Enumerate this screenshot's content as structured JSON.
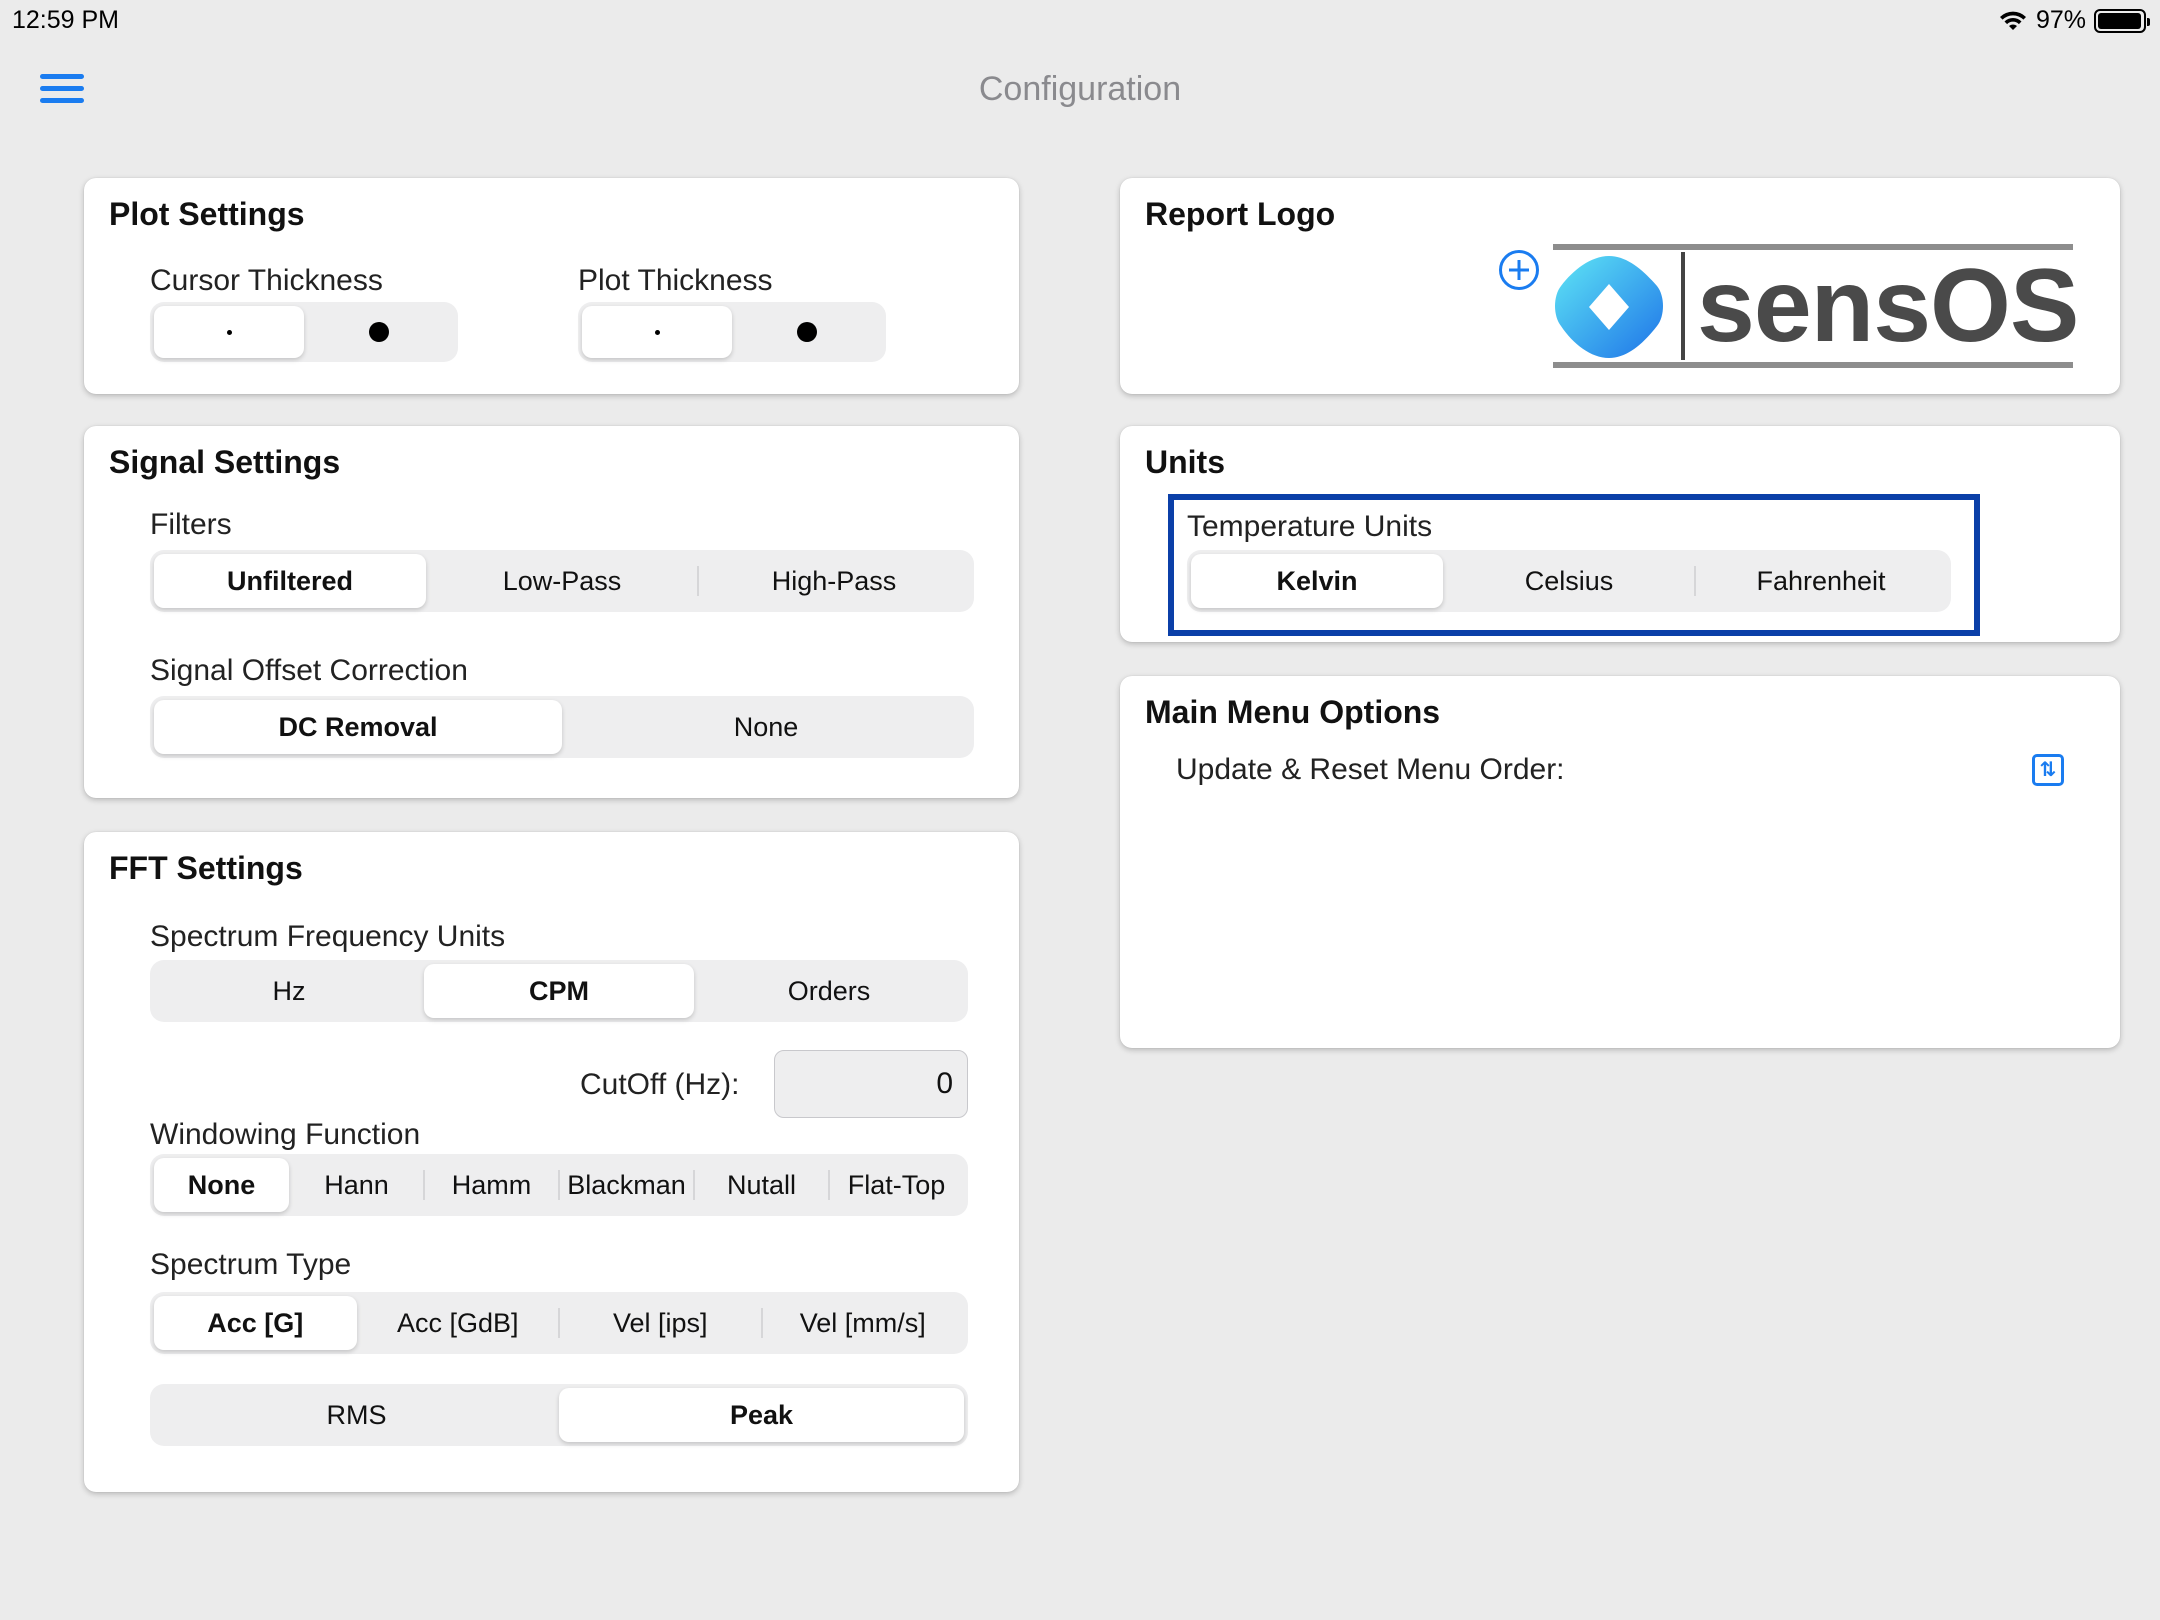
{
  "status_bar": {
    "time": "12:59 PM",
    "battery": "97%",
    "battery_level": 0.97
  },
  "nav": {
    "title": "Configuration"
  },
  "plot_settings": {
    "title": "Plot Settings",
    "cursor_thickness_label": "Cursor Thickness",
    "plot_thickness_label": "Plot Thickness",
    "cursor_selected": "thin",
    "plot_selected": "thin"
  },
  "signal_settings": {
    "title": "Signal Settings",
    "filters_label": "Filters",
    "filters": [
      "Unfiltered",
      "Low-Pass",
      "High-Pass"
    ],
    "filters_selected": "Unfiltered",
    "offset_label": "Signal Offset Correction",
    "offset_options": [
      "DC Removal",
      "None"
    ],
    "offset_selected": "DC Removal"
  },
  "fft_settings": {
    "title": "FFT Settings",
    "freq_units_label": "Spectrum Frequency Units",
    "freq_units": [
      "Hz",
      "CPM",
      "Orders"
    ],
    "freq_units_selected": "CPM",
    "cutoff_label": "CutOff (Hz):",
    "cutoff_value": "0",
    "windowing_label": "Windowing Function",
    "windowing": [
      "None",
      "Hann",
      "Hamm",
      "Blackman",
      "Nutall",
      "Flat-Top"
    ],
    "windowing_selected": "None",
    "spectrum_type_label": "Spectrum Type",
    "spectrum_types": [
      "Acc [G]",
      "Acc [GdB]",
      "Vel [ips]",
      "Vel [mm/s]"
    ],
    "spectrum_type_selected": "Acc [G]",
    "amplitude_modes": [
      "RMS",
      "Peak"
    ],
    "amplitude_selected": "Peak"
  },
  "report_logo": {
    "title": "Report Logo",
    "logo_text": "sensOS"
  },
  "units": {
    "title": "Units",
    "temperature_label": "Temperature Units",
    "temperature_options": [
      "Kelvin",
      "Celsius",
      "Fahrenheit"
    ],
    "temperature_selected": "Kelvin"
  },
  "main_menu": {
    "title": "Main Menu Options",
    "reorder_label": "Update & Reset Menu Order:"
  },
  "colors": {
    "accent": "#1a7cf0",
    "highlight": "#0b3fa8",
    "background": "#ebebeb"
  }
}
